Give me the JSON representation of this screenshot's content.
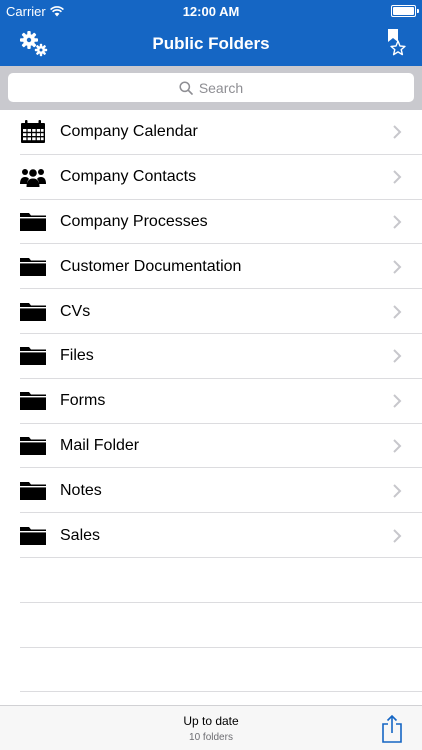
{
  "status_bar": {
    "carrier": "Carrier",
    "time": "12:00 AM"
  },
  "nav": {
    "title": "Public Folders",
    "left_icon": "gears-icon",
    "right_icon": "bookmark-star-icon"
  },
  "search": {
    "placeholder": "Search"
  },
  "folders": [
    {
      "label": "Company Calendar",
      "icon": "calendar-icon"
    },
    {
      "label": "Company Contacts",
      "icon": "contacts-icon"
    },
    {
      "label": "Company Processes",
      "icon": "folder-icon"
    },
    {
      "label": "Customer Documentation",
      "icon": "folder-icon"
    },
    {
      "label": "CVs",
      "icon": "folder-icon"
    },
    {
      "label": "Files",
      "icon": "folder-icon"
    },
    {
      "label": "Forms",
      "icon": "folder-icon"
    },
    {
      "label": "Mail Folder",
      "icon": "folder-icon"
    },
    {
      "label": "Notes",
      "icon": "folder-icon"
    },
    {
      "label": "Sales",
      "icon": "folder-icon"
    }
  ],
  "toolbar": {
    "status": "Up to date",
    "count": "10 folders",
    "share_icon": "share-icon"
  },
  "colors": {
    "brand": "#1566c4",
    "separator": "#dcdcdf",
    "search_bg": "#c9c9ce"
  }
}
